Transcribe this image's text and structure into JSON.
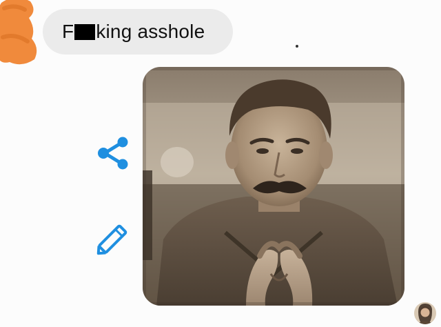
{
  "conversation": {
    "incoming_message": {
      "text_prefix": "F",
      "text_suffix": "king asshole"
    },
    "sent_photo": {
      "alt_subject": "photo-message"
    }
  },
  "actions": {
    "share_icon": "share-icon",
    "edit_icon": "pencil-icon"
  },
  "colors": {
    "bubble_background": "#ebebeb",
    "accent_blue": "#1f8fe0",
    "redaction_orange": "#f08a3c",
    "background": "#fcfcfc"
  }
}
